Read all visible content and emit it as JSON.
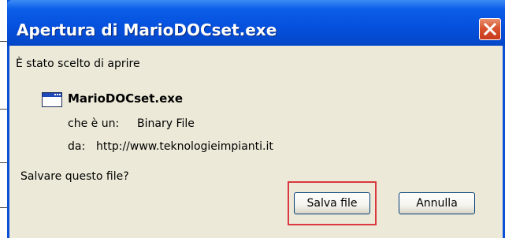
{
  "dialog": {
    "title": "Apertura di MarioDOCset.exe",
    "intro": "È stato scelto di aprire",
    "file": {
      "icon": "application-window-icon",
      "name": "MarioDOCset.exe",
      "type_label": "che è un:",
      "type_value": "Binary File",
      "source_label": "da:",
      "source_value": "http://www.teknologieimpianti.it"
    },
    "question": "Salvare questo file?",
    "buttons": {
      "save": "Salva file",
      "cancel": "Annulla"
    }
  },
  "colors": {
    "titlebar": "#0550dc",
    "client_bg": "#ece9d8",
    "close_button": "#d8542f",
    "highlight_border": "#d9393f"
  }
}
